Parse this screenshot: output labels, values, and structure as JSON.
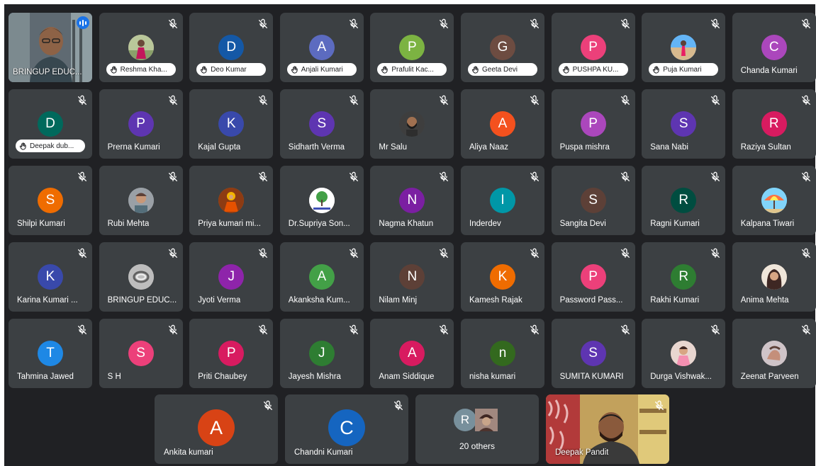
{
  "participants_grid": [
    {
      "name": "BRINGUP EDUC...",
      "initial": "",
      "color": "",
      "avatar": "video-self",
      "pill": false,
      "speaking": true
    },
    {
      "name": "Reshma Kha...",
      "initial": "",
      "color": "#c98b9a",
      "avatar": "photo-woman-field",
      "pill": true
    },
    {
      "name": "Deo Kumar",
      "initial": "D",
      "color": "#1458a6",
      "avatar": "letter",
      "pill": true
    },
    {
      "name": "Anjali Kumari",
      "initial": "A",
      "color": "#5c6bc0",
      "avatar": "letter",
      "pill": true
    },
    {
      "name": "Prafulit Kac...",
      "initial": "P",
      "color": "#7cb342",
      "avatar": "letter",
      "pill": true
    },
    {
      "name": "Geeta Devi",
      "initial": "G",
      "color": "#6d4c41",
      "avatar": "letter",
      "pill": true
    },
    {
      "name": "PUSHPA KU...",
      "initial": "P",
      "color": "#ec407a",
      "avatar": "letter",
      "pill": true
    },
    {
      "name": "Puja Kumari",
      "initial": "",
      "color": "#64b5f6",
      "avatar": "photo-beach",
      "pill": true
    },
    {
      "name": "Chanda Kumari",
      "initial": "C",
      "color": "#ab47bc",
      "avatar": "letter",
      "pill": false
    },
    {
      "name": "Deepak dub...",
      "initial": "D",
      "color": "#00695c",
      "avatar": "letter",
      "pill": true
    },
    {
      "name": "Prerna Kumari",
      "initial": "P",
      "color": "#5e35b1",
      "avatar": "letter",
      "pill": false
    },
    {
      "name": "Kajal Gupta",
      "initial": "K",
      "color": "#3949ab",
      "avatar": "letter",
      "pill": false
    },
    {
      "name": "Sidharth Verma",
      "initial": "S",
      "color": "#5e35b1",
      "avatar": "letter",
      "pill": false
    },
    {
      "name": "Mr Salu",
      "initial": "",
      "color": "#4a4a4a",
      "avatar": "photo-man-beard",
      "pill": false
    },
    {
      "name": "Aliya Naaz",
      "initial": "A",
      "color": "#f4511e",
      "avatar": "letter",
      "pill": false
    },
    {
      "name": "Puspa mishra",
      "initial": "P",
      "color": "#ab47bc",
      "avatar": "letter",
      "pill": false
    },
    {
      "name": "Sana Nabi",
      "initial": "S",
      "color": "#5e35b1",
      "avatar": "letter",
      "pill": false
    },
    {
      "name": "Raziya Sultan",
      "initial": "R",
      "color": "#d81b60",
      "avatar": "letter",
      "pill": false
    },
    {
      "name": "Shilpi Kumari",
      "initial": "S",
      "color": "#ef6c00",
      "avatar": "letter",
      "pill": false
    },
    {
      "name": "Rubi Mehta",
      "initial": "",
      "color": "#8d8d8d",
      "avatar": "photo-man-cap",
      "pill": false
    },
    {
      "name": "Priya kumari mi...",
      "initial": "",
      "color": "#c56a1e",
      "avatar": "photo-deity",
      "pill": false
    },
    {
      "name": "Dr.Supriya Son...",
      "initial": "",
      "color": "#ffffff",
      "avatar": "photo-tree-logo",
      "pill": false
    },
    {
      "name": "Nagma Khatun",
      "initial": "N",
      "color": "#7b1fa2",
      "avatar": "letter",
      "pill": false
    },
    {
      "name": "Inderdev",
      "initial": "I",
      "color": "#0097a7",
      "avatar": "letter",
      "pill": false
    },
    {
      "name": "Sangita Devi",
      "initial": "S",
      "color": "#5d4037",
      "avatar": "letter",
      "pill": false
    },
    {
      "name": "Ragni Kumari",
      "initial": "R",
      "color": "#004d40",
      "avatar": "letter",
      "pill": false
    },
    {
      "name": "Kalpana Tiwari",
      "initial": "",
      "color": "#4fc3f7",
      "avatar": "photo-umbrella",
      "pill": false
    },
    {
      "name": "Karina Kumari ...",
      "initial": "K",
      "color": "#3949ab",
      "avatar": "letter",
      "pill": false
    },
    {
      "name": "BRINGUP EDUC...",
      "initial": "",
      "color": "#9e9e9e",
      "avatar": "photo-ring",
      "pill": false
    },
    {
      "name": "Jyoti Verma",
      "initial": "J",
      "color": "#8e24aa",
      "avatar": "letter",
      "pill": false
    },
    {
      "name": "Akanksha Kum...",
      "initial": "A",
      "color": "#43a047",
      "avatar": "letter",
      "pill": false
    },
    {
      "name": "Nilam Minj",
      "initial": "N",
      "color": "#5d4037",
      "avatar": "letter",
      "pill": false
    },
    {
      "name": "Kamesh Rajak",
      "initial": "K",
      "color": "#ef6c00",
      "avatar": "letter",
      "pill": false
    },
    {
      "name": "Password Pass...",
      "initial": "P",
      "color": "#ec407a",
      "avatar": "letter",
      "pill": false
    },
    {
      "name": "Rakhi Kumari",
      "initial": "R",
      "color": "#2e7d32",
      "avatar": "letter",
      "pill": false
    },
    {
      "name": "Anima Mehta",
      "initial": "",
      "color": "#6d4c41",
      "avatar": "photo-woman-hair",
      "pill": false
    },
    {
      "name": "Tahmina Jawed",
      "initial": "T",
      "color": "#1e88e5",
      "avatar": "letter",
      "pill": false
    },
    {
      "name": "S H",
      "initial": "S",
      "color": "#ec407a",
      "avatar": "letter",
      "pill": false
    },
    {
      "name": "Priti Chaubey",
      "initial": "P",
      "color": "#d81b60",
      "avatar": "letter",
      "pill": false
    },
    {
      "name": "Jayesh Mishra",
      "initial": "J",
      "color": "#2e7d32",
      "avatar": "letter",
      "pill": false
    },
    {
      "name": "Anam Siddique",
      "initial": "A",
      "color": "#d81b60",
      "avatar": "letter",
      "pill": false
    },
    {
      "name": "nisha kumari",
      "initial": "n",
      "color": "#33691e",
      "avatar": "letter",
      "pill": false
    },
    {
      "name": "SUMITA KUMARI",
      "initial": "S",
      "color": "#5e35b1",
      "avatar": "letter",
      "pill": false
    },
    {
      "name": "Durga Vishwak...",
      "initial": "",
      "color": "#c9a0a0",
      "avatar": "photo-woman-pink",
      "pill": false
    },
    {
      "name": "Zeenat Parveen",
      "initial": "",
      "color": "#b0a0a8",
      "avatar": "photo-hands",
      "pill": false
    }
  ],
  "bottom_row": [
    {
      "name": "Ankita kumari",
      "initial": "A",
      "color": "#d84315",
      "kind": "letter"
    },
    {
      "name": "Chandni Kumari",
      "initial": "C",
      "color": "#1565c0",
      "kind": "letter"
    },
    {
      "name": "",
      "kind": "others",
      "label": "20 others",
      "avatars": [
        {
          "initial": "R",
          "color": "#78909c"
        },
        {
          "initial": "",
          "color": "#a1887f"
        }
      ]
    },
    {
      "name": "Deepak Pandit",
      "kind": "video"
    }
  ],
  "icons": {
    "muted": "mic-off-icon",
    "raised_hand": "raised-hand-icon",
    "speaking": "audio-level-icon"
  }
}
